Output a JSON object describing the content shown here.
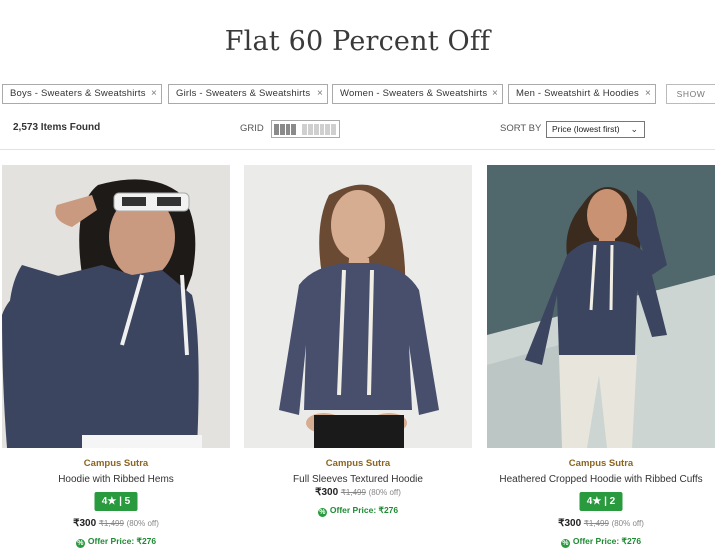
{
  "page": {
    "title": "Flat 60 Percent Off"
  },
  "filters": [
    {
      "label": "Boys - Sweaters & Sweatshirts",
      "remove": "×"
    },
    {
      "label": "Girls - Sweaters & Sweatshirts",
      "remove": "×"
    },
    {
      "label": "Women - Sweaters & Sweatshirts",
      "remove": "×"
    },
    {
      "label": "Men - Sweatshirt & Hoodies",
      "remove": "×"
    }
  ],
  "show_label": "SHOW",
  "toolbar": {
    "items_found": "2,573 Items Found",
    "grid_label": "GRID",
    "sort_label": "SORT BY",
    "sort_value": "Price (lowest first)",
    "sort_chevron": "⌄"
  },
  "products": [
    {
      "brand": "Campus Sutra",
      "name": "Hoodie with Ribbed Hems",
      "rating": "4★ | 5",
      "price": "₹300",
      "mrp": "₹1,499",
      "discount": "(80% off)",
      "offer": "Offer Price: ₹276"
    },
    {
      "brand": "Campus Sutra",
      "name": "Full Sleeves Textured Hoodie",
      "rating": "",
      "price": "₹300",
      "mrp": "₹1,499",
      "discount": "(80% off)",
      "offer": "Offer Price: ₹276"
    },
    {
      "brand": "Campus Sutra",
      "name": "Heathered Cropped Hoodie with Ribbed Cuffs",
      "rating": "4★ | 2",
      "price": "₹300",
      "mrp": "₹1,499",
      "discount": "(80% off)",
      "offer": "Offer Price: ₹276"
    }
  ],
  "colors": {
    "brand": "#8a6620",
    "rating_bg": "#2a9a3e",
    "offer": "#1f8a34",
    "hoodie": "#3c4560"
  },
  "icons": {
    "remove": "close-icon",
    "offer": "percent-badge-icon",
    "grid": "grid-view-icon"
  }
}
